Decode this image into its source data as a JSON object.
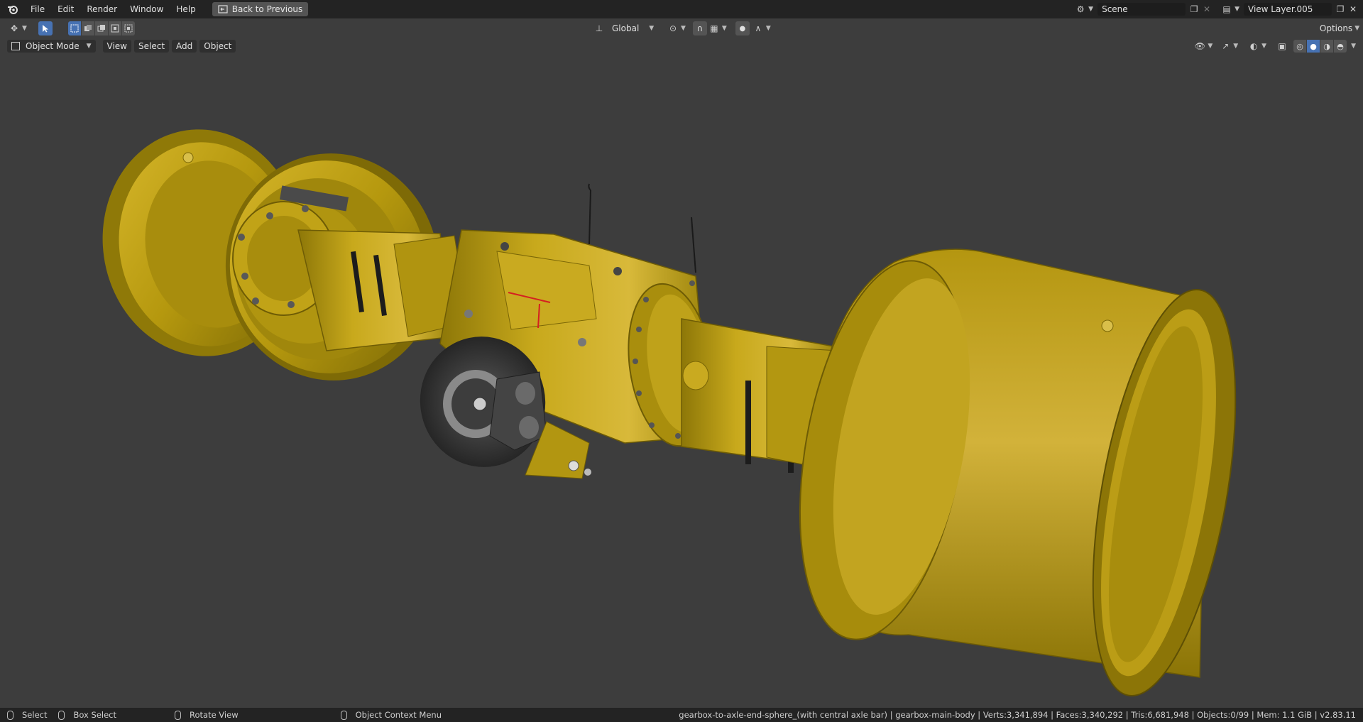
{
  "topbar": {
    "menus": [
      "File",
      "Edit",
      "Render",
      "Window",
      "Help"
    ],
    "back_button": "Back to Previous",
    "scene_name": "Scene",
    "view_layer": "View Layer.005"
  },
  "toolheader": {
    "orientation": "Global",
    "options_label": "Options"
  },
  "viewport_header": {
    "mode": "Object Mode",
    "menus": [
      "View",
      "Select",
      "Add",
      "Object"
    ]
  },
  "statusbar": {
    "select": "Select",
    "box_select": "Box Select",
    "rotate_view": "Rotate View",
    "context_menu": "Object Context Menu",
    "info": "gearbox-to-axle-end-sphere_(with central axle bar) | gearbox-main-body | Verts:3,341,894 | Faces:3,340,292 | Tris:6,681,948 | Objects:0/99 | Mem: 1.1 GiB | v2.83.11"
  },
  "colors": {
    "model_yellow": "#b99c10",
    "model_highlight": "#d8b930",
    "model_shadow": "#6e5c05",
    "brake_disc": "#3a3a3a",
    "selection_blue": "#4772b3"
  }
}
